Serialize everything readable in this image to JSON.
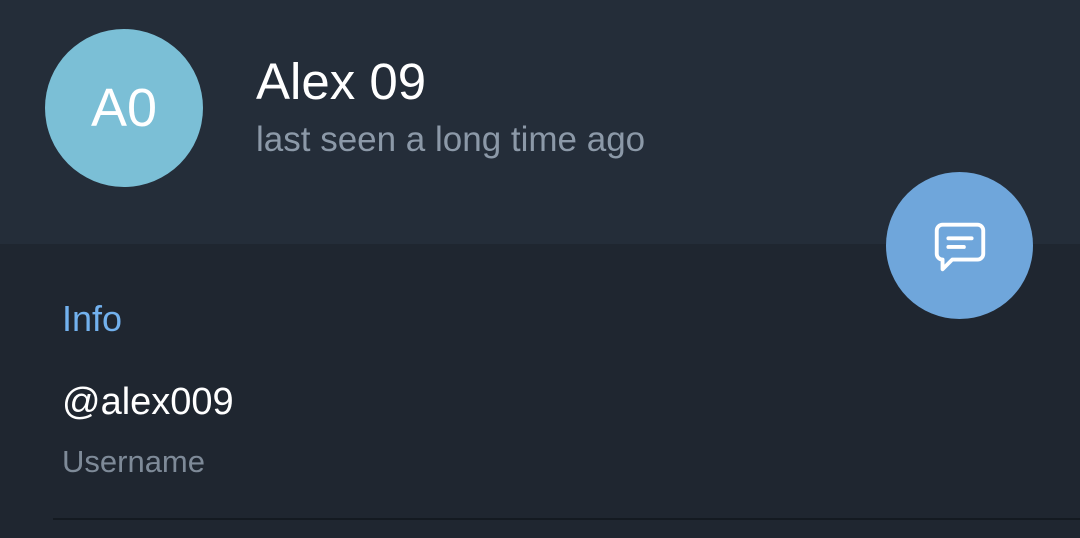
{
  "profile": {
    "avatar_initials": "A0",
    "avatar_color": "#7bbfd6",
    "name": "Alex 09",
    "status": "last seen a long time ago"
  },
  "fab": {
    "icon": "message-icon",
    "color": "#6fa6db"
  },
  "info": {
    "section_title": "Info",
    "username_value": "@alex009",
    "username_label": "Username"
  }
}
